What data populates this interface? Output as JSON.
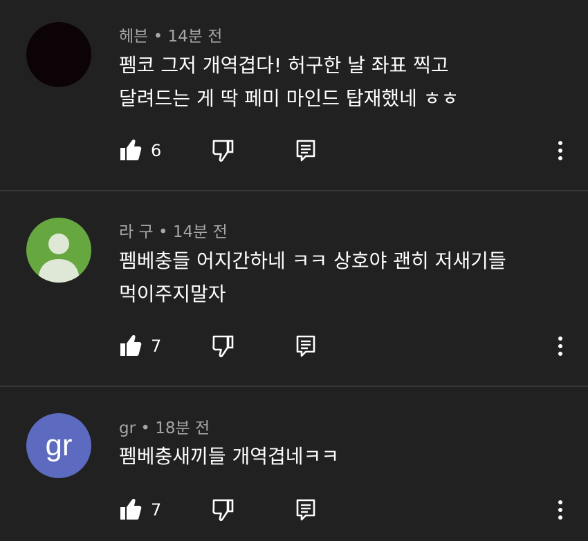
{
  "comments": [
    {
      "author": "헤븐",
      "time": "14분 전",
      "lines": [
        "펨코 그저 개역겹다! 허구한 날 좌표 찍고",
        "달려드는 게 딱 페미 마인드 탑재했네 ㅎㅎ"
      ],
      "likes": "6",
      "avatar": "dark-avatar"
    },
    {
      "author": "라 구",
      "time": "14분 전",
      "lines": [
        "펨베충들 어지간하네 ㅋㅋ 상호야 괜히 저새기들",
        "먹이주지말자"
      ],
      "likes": "7",
      "avatar": "default-person-avatar"
    },
    {
      "author": "gr",
      "time": "18분 전",
      "lines": [
        "펨베충새끼들 개역겹네ㅋㅋ"
      ],
      "likes": "7",
      "avatar_text": "gr"
    }
  ],
  "meta_separator": "•",
  "icons": {
    "like": "thumbs-up-icon",
    "dislike": "thumbs-down-icon",
    "reply": "reply-icon",
    "more": "more-vertical-icon"
  },
  "colors": {
    "background": "#212121",
    "divider": "#373737",
    "meta": "#a6a6a6",
    "avatar_green": "#66a83f",
    "avatar_blue": "#5c6bc0"
  }
}
